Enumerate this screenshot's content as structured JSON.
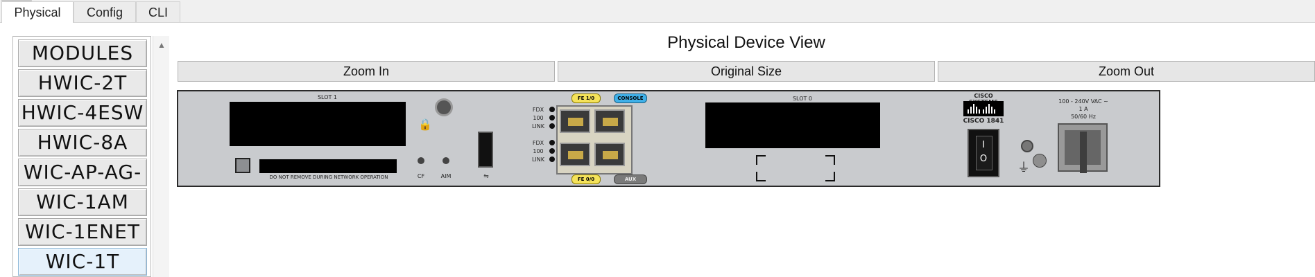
{
  "tabs": [
    {
      "label": "Physical",
      "active": true
    },
    {
      "label": "Config",
      "active": false
    },
    {
      "label": "CLI",
      "active": false
    }
  ],
  "modules": {
    "items": [
      "MODULES",
      "HWIC-2T",
      "HWIC-4ESW",
      "HWIC-8A",
      "WIC-AP-AG-",
      "WIC-1AM",
      "WIC-1ENET",
      "WIC-1T"
    ],
    "selected_index": 7
  },
  "view": {
    "title": "Physical Device View",
    "zoom_in": "Zoom In",
    "original_size": "Original Size",
    "zoom_out": "Zoom Out"
  },
  "device": {
    "slot1_label": "SLOT 1",
    "slot0_label": "SLOT 0",
    "warning": "DO NOT REMOVE DURING NETWORK OPERATION",
    "cf_label": "CF",
    "aim_label": "AIM",
    "fdx": "FDX",
    "speed": "100",
    "link": "LINK",
    "fe10": "FE 1/0",
    "fe00": "FE 0/0",
    "console": "CONSOLE",
    "aux": "AUX",
    "brand": "CISCO SYSTEMS",
    "model": "CISCO 1841",
    "power_rating_1": "100 - 240V VAC ~",
    "power_rating_2": "1 A",
    "power_rating_3": "50/60 Hz",
    "switch_on": "I",
    "switch_off": "O"
  },
  "colors": {
    "chassis": "#c9cbce",
    "port_gold": "#c8a948",
    "label_yellow": "#f5e35a",
    "label_blue": "#3fb0e8"
  }
}
